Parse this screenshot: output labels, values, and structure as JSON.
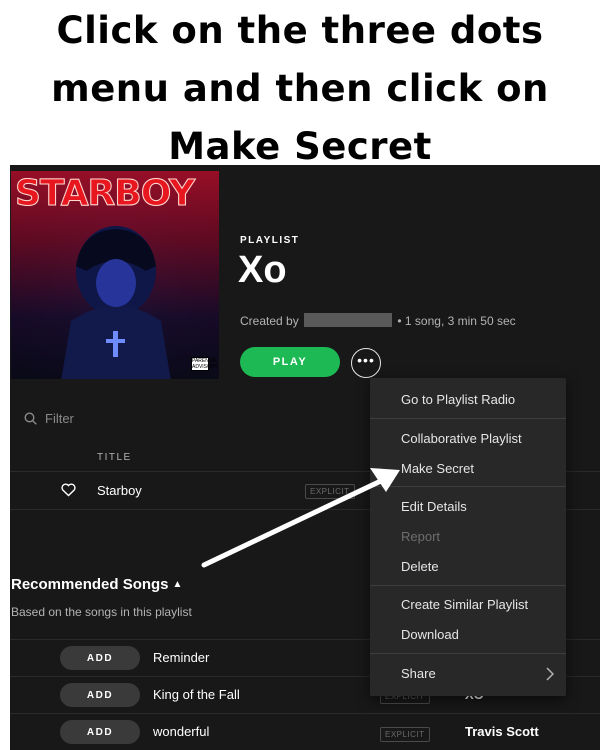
{
  "instruction": {
    "line1": "Click on the three dots",
    "line2": "menu and then click on",
    "line3": "Make Secret"
  },
  "album": {
    "title": "STARBOY",
    "badge": "PARENTAL ADVISORY"
  },
  "playlist": {
    "kind": "PLAYLIST",
    "title": "Xo",
    "created_by_prefix": "Created by",
    "meta_suffix": "• 1 song, 3 min 50 sec",
    "play_label": "PLAY",
    "more_label": "•••"
  },
  "filter": {
    "placeholder": "Filter"
  },
  "tracklist": {
    "col_title": "TITLE",
    "tracks": [
      {
        "name": "Starboy",
        "explicit": "EXPLICIT"
      }
    ]
  },
  "recommended": {
    "title": "Recommended Songs",
    "caret": "▲",
    "subtitle": "Based on the songs in this playlist",
    "add_label": "ADD",
    "rows": [
      {
        "name": "Reminder",
        "explicit": "",
        "artist": ""
      },
      {
        "name": "King of the Fall",
        "explicit": "EXPLICIT",
        "artist": "XO"
      },
      {
        "name": "wonderful",
        "explicit": "EXPLICIT",
        "artist": "Travis Scott"
      }
    ]
  },
  "context_menu": {
    "items": [
      {
        "label": "Go to Playlist Radio"
      },
      {
        "label": "Collaborative Playlist"
      },
      {
        "label": "Make Secret"
      },
      {
        "label": "Edit Details"
      },
      {
        "label": "Report",
        "disabled": true
      },
      {
        "label": "Delete"
      },
      {
        "label": "Create Similar Playlist"
      },
      {
        "label": "Download"
      },
      {
        "label": "Share"
      }
    ]
  },
  "colors": {
    "accent": "#1db954",
    "background": "#181818",
    "menu_background": "#282828"
  }
}
